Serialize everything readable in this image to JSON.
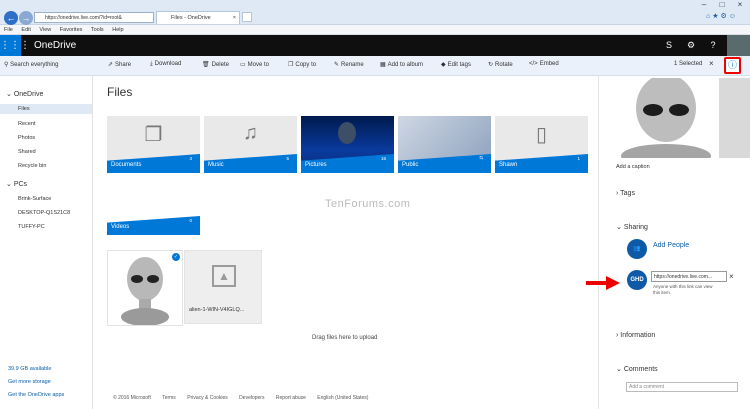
{
  "browser": {
    "address": "https://onedrive.live.com/?id=root&",
    "tab_title": "Files - OneDrive",
    "menu": [
      "File",
      "Edit",
      "View",
      "Favorites",
      "Tools",
      "Help"
    ]
  },
  "header": {
    "app_name": "OneDrive"
  },
  "toolbar": {
    "search": "Search everything",
    "commands": [
      "Share",
      "Download",
      "Delete",
      "Move to",
      "Copy to",
      "Rename",
      "Add to album",
      "Edit tags",
      "Rotate",
      "Embed"
    ],
    "selected": "1 Selected"
  },
  "sidebar": {
    "onedrive_label": "OneDrive",
    "items": [
      "Files",
      "Recent",
      "Photos",
      "Shared",
      "Recycle bin"
    ],
    "pcs_label": "PCs",
    "pcs": [
      "Brink-Surface",
      "DESKTOP-Q1S21C8",
      "TUFFY-PC"
    ],
    "storage": "39.9 GB available",
    "get_storage": "Get more storage",
    "get_apps": "Get the OneDrive apps"
  },
  "main": {
    "title": "Files",
    "folders": [
      {
        "name": "Documents",
        "count": "3"
      },
      {
        "name": "Music",
        "count": "5"
      },
      {
        "name": "Pictures",
        "count": "16"
      },
      {
        "name": "Public",
        "count": ""
      },
      {
        "name": "Shawn",
        "count": "1"
      },
      {
        "name": "Videos",
        "count": "0"
      }
    ],
    "file2_name": "alien-1-WIN-V4IGLQ...",
    "drag_hint": "Drag files here to upload",
    "watermark": "TenForums.com",
    "footer": [
      "© 2016 Microsoft",
      "Terms",
      "Privacy & Cookies",
      "Developers",
      "Report abuse",
      "English (United States)"
    ]
  },
  "details": {
    "caption": "Add a caption",
    "tags": "Tags",
    "sharing": "Sharing",
    "add_people": "Add People",
    "avatar_initials": "GHD",
    "link": "https://onedrive.live.com...",
    "link_note": "Anyone with this link can view this item.",
    "information": "Information",
    "comments": "Comments",
    "comment_placeholder": "Add a comment"
  },
  "colors": {
    "accent": "#0078d7",
    "header": "#0f0f0f",
    "highlight": "#e00000"
  }
}
